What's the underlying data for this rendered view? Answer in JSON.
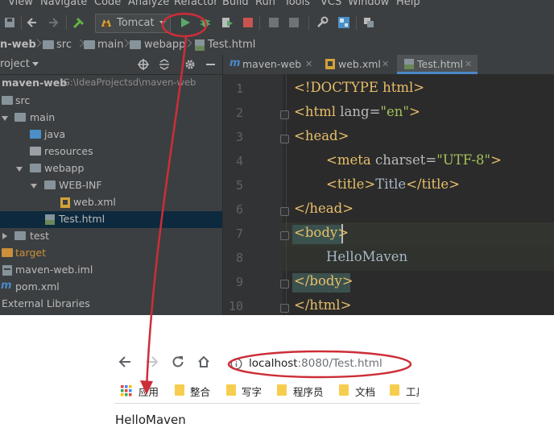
{
  "ide": {
    "menu": [
      "View",
      "Navigate",
      "Code",
      "Analyze",
      "Refactor",
      "Build",
      "Run",
      "Tools",
      "VCS",
      "Window",
      "Help"
    ],
    "run_config": "Tomcat",
    "breadcrumb": [
      "n-web",
      "src",
      "main",
      "webapp",
      "Test.html"
    ],
    "project_header": "roject",
    "tree": [
      {
        "label": "maven-web",
        "path": "G:\\IdeaProjectsd\\maven-web"
      },
      {
        "label": "src"
      },
      {
        "label": "main"
      },
      {
        "label": "java"
      },
      {
        "label": "resources"
      },
      {
        "label": "webapp"
      },
      {
        "label": "WEB-INF"
      },
      {
        "label": "web.xml"
      },
      {
        "label": "Test.html"
      },
      {
        "label": "test"
      },
      {
        "label": "target"
      },
      {
        "label": "maven-web.iml"
      },
      {
        "label": "pom.xml"
      },
      {
        "label": "External Libraries"
      }
    ],
    "tabs": [
      "maven-web",
      "web.xml",
      "Test.html"
    ],
    "line_numbers": [
      "1",
      "2",
      "3",
      "4",
      "5",
      "6",
      "7",
      "8",
      "9",
      "10"
    ],
    "code": {
      "l1": "<!DOCTYPE html>",
      "l2_tag1": "<html ",
      "l2_attr": "lang=",
      "l2_val": "\"en\"",
      "l2_tag2": ">",
      "l3": "<head>",
      "l4_tag1": "<meta ",
      "l4_attr": "charset=",
      "l4_val": "\"UTF-8\"",
      "l4_tag2": ">",
      "l5_open": "<title>",
      "l5_text": "Title",
      "l5_close": "</title>",
      "l6": "</head>",
      "l7": "<body>",
      "l8": "HelloMaven",
      "l9": "</body>",
      "l10": "</html>"
    }
  },
  "browser": {
    "url_host": "localhost",
    "url_rest": ":8080/Test.html",
    "bookmarks": [
      "应用",
      "整合",
      "写字",
      "程序员",
      "文档",
      "工具"
    ],
    "page_text": "HelloMaven"
  },
  "colors": {
    "annotation": "#cc2e38",
    "ide_bg": "#3c3f41",
    "editor_bg": "#2b2b2b",
    "tag": "#e8bf6a",
    "string": "#a5c25c"
  }
}
